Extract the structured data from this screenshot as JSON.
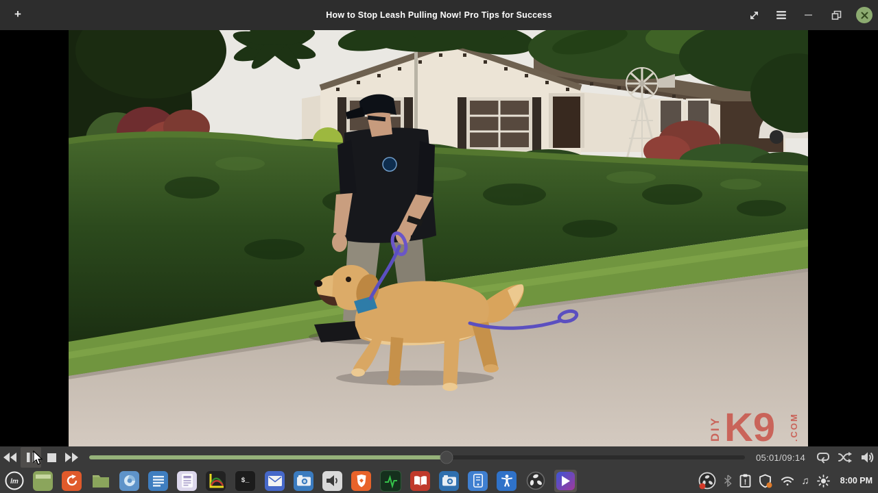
{
  "window": {
    "title": "How to Stop Leash Pulling Now! Pro Tips for Success",
    "add_button": "+"
  },
  "video_overlay": {
    "watermark_diy": "DIY",
    "watermark_k9": "K9",
    "watermark_com": ".COM"
  },
  "controls": {
    "time_display": "05:01/09:14",
    "progress_percent": 54.5
  },
  "taskbar": {
    "clock": "8:00 PM",
    "mint_logo_text": "lm",
    "terminal_glyph": "$_",
    "apps": [
      "mint-menu",
      "show-desktop",
      "orange-refresh-app",
      "file-manager",
      "blue-browser",
      "writer-document",
      "notes-document",
      "chart-plot",
      "terminal",
      "mail",
      "screenshot-camera",
      "sound-settings",
      "brave-browser",
      "system-monitor",
      "ebook-reader",
      "photos-camera",
      "mobile-device",
      "accessibility",
      "obs-studio",
      "media-player-active"
    ],
    "tray_icons": [
      "obs-recording",
      "bluetooth",
      "clipboard-alert",
      "shield-update",
      "wifi",
      "music-note",
      "brightness"
    ]
  },
  "colors": {
    "close_button_green": "#8cab70",
    "progress_green": "#96b27a",
    "watermark_red": "#c8493f",
    "titlebar_bg": "#2d2d2d",
    "bar_bg": "#3a3a3a"
  }
}
